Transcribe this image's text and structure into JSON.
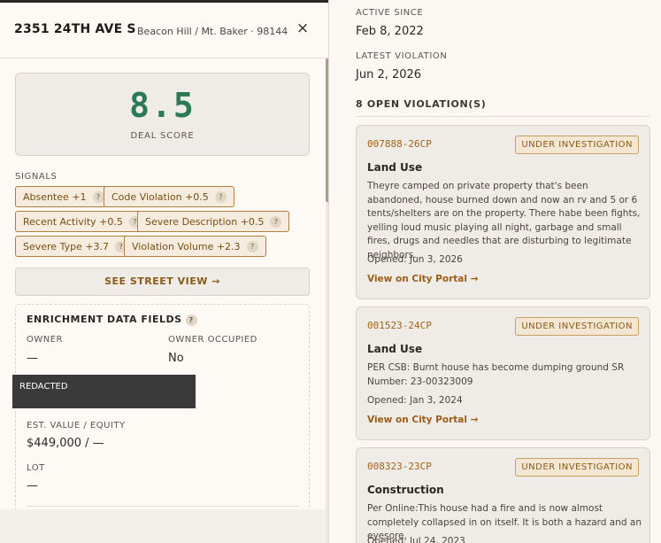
{
  "header": {
    "address": "2351 24TH AVE S",
    "neighborhood": "Beacon Hill / Mt. Baker · 98144",
    "close_glyph": "×"
  },
  "score": {
    "value": "8.5",
    "label": "DEAL SCORE"
  },
  "signals": {
    "label": "SIGNALS",
    "help_glyph": "?",
    "chips": [
      {
        "label": "Absentee +1"
      },
      {
        "label": "Code Violation +0.5"
      },
      {
        "label": "Recent Activity +0.5"
      },
      {
        "label": "Severe Description +0.5"
      },
      {
        "label": "Severe Type +3.7"
      },
      {
        "label": "Violation Volume +2.3"
      }
    ]
  },
  "street_view": {
    "label": "SEE STREET VIEW →"
  },
  "enrichment": {
    "title": "ENRICHMENT DATA FIELDS",
    "help_glyph": "?",
    "owner_label": "OWNER",
    "owner_value": "—",
    "owner_occupied_label": "OWNER OCCUPIED",
    "owner_occupied_value": "No",
    "redacted_label": "REDACTED",
    "value_label": "EST. VALUE / EQUITY",
    "value_value": "$449,000 / —",
    "lot_label": "LOT",
    "lot_value": "—"
  },
  "summary": {
    "active_since_label": "ACTIVE SINCE",
    "active_since_value": "Feb 8, 2022",
    "latest_violation_label": "LATEST VIOLATION",
    "latest_violation_value": "Jun 2, 2026",
    "open_count": "8 OPEN VIOLATION(S)"
  },
  "violations": [
    {
      "id": "007888-26CP",
      "status": "UNDER INVESTIGATION",
      "type": "Land Use",
      "description": "Theyre camped on private property that's been abandoned, house burned down and now an rv and 5 or 6 tents/shelters are on the property. There habe been fights, yelling loud music playing all night, garbage and small fires, drugs and needles that are disturbing to legitimate neighbors.",
      "opened": "Opened: Jun 3, 2026",
      "link": "View on City Portal →"
    },
    {
      "id": "001523-24CP",
      "status": "UNDER INVESTIGATION",
      "type": "Land Use",
      "description": "PER CSB: Burnt house has become dumping ground SR Number: 23-00323009",
      "opened": "Opened: Jan 3, 2024",
      "link": "View on City Portal →"
    },
    {
      "id": "008323-23CP",
      "status": "UNDER INVESTIGATION",
      "type": "Construction",
      "description": "Per Online:This house had a fire and is now almost completely collapsed in on itself. It is both a hazard and an eyesore.",
      "opened": "Opened: Jul 24, 2023",
      "link": ""
    }
  ]
}
